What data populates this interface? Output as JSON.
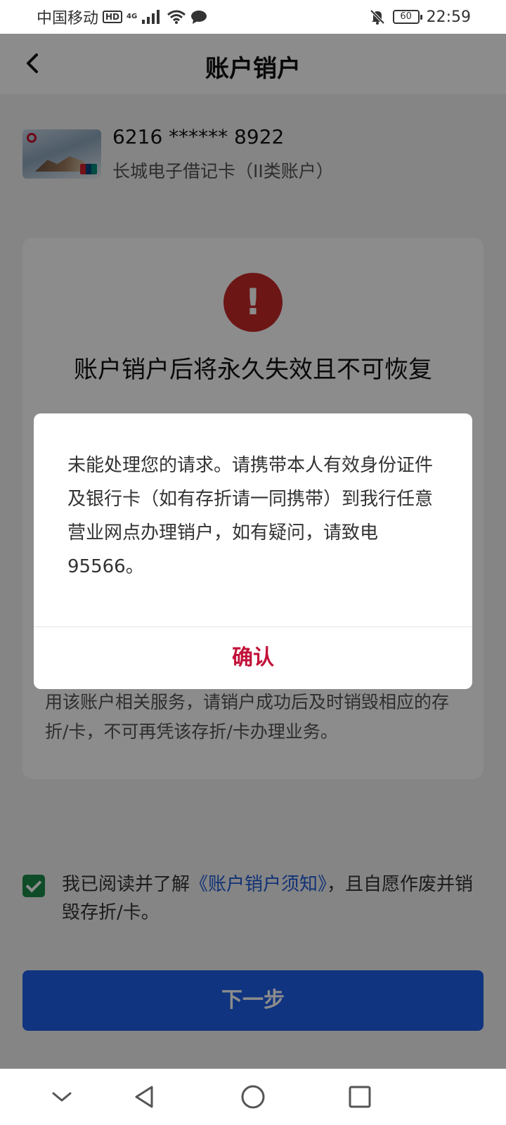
{
  "status_bar": {
    "carrier": "中国移动",
    "hd_badge": "HD",
    "network": "4G",
    "battery": "60",
    "time": "22:59",
    "icons": [
      "signal-icon",
      "wifi-icon",
      "message-icon",
      "mute-bell-icon",
      "battery-icon"
    ]
  },
  "header": {
    "title": "账户销户"
  },
  "card": {
    "number": "6216 ****** 8922",
    "type": "长城电子借记卡（II类账户）"
  },
  "notice": {
    "warning_title": "账户销户后将永久失效且不可恢复",
    "body_tail": "用该账户相关服务，请销户成功后及时销毁相应的存折/卡，不可再凭该存折/卡办理业务。"
  },
  "agreement": {
    "prefix": "我已阅读并了解",
    "link": "《账户销户须知》",
    "suffix": "，且自愿作废并销毁存折/卡。",
    "checked": true
  },
  "next_button": {
    "label": "下一步"
  },
  "dialog": {
    "message": "未能处理您的请求。请携带本人有效身份证件及银行卡（如有存折请一同携带）到我行任意营业网点办理销户，如有疑问，请致电95566。",
    "confirm_label": "确认"
  },
  "colors": {
    "accent_blue": "#1e5fe8",
    "confirm_red": "#c2133a",
    "warning_red": "#c62828",
    "check_green": "#1a8a4a"
  }
}
